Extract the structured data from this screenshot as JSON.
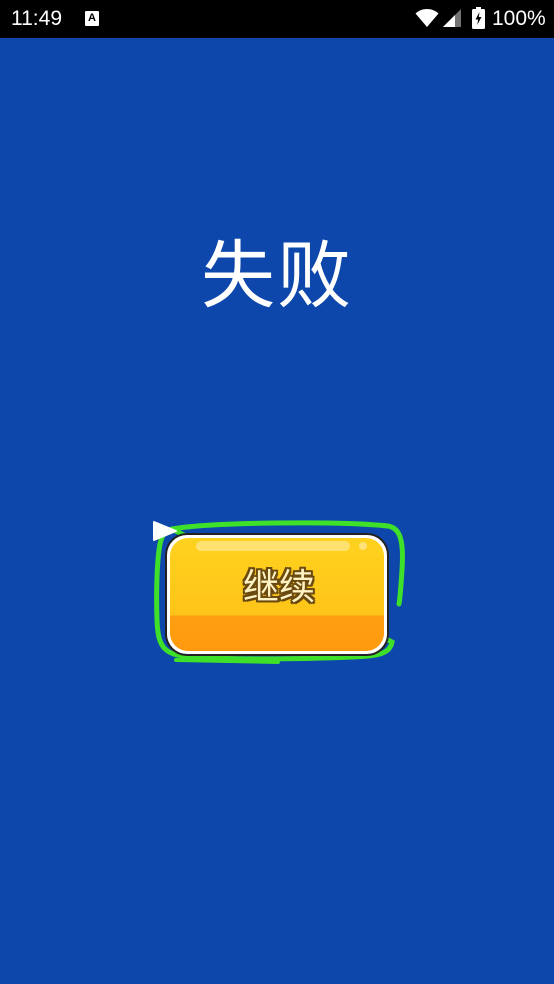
{
  "status_bar": {
    "time": "11:49",
    "notification_letter": "A",
    "battery_percent": "100%"
  },
  "game": {
    "result_title": "失败",
    "continue_label": "继续"
  },
  "colors": {
    "background": "#0d47ab",
    "status_bar": "#000000",
    "button_fill": "#ffc61a",
    "button_bottom": "#ff9f10",
    "button_outline_glow": "#3fe02a"
  },
  "icons": {
    "wifi": "wifi-icon",
    "signal": "signal-icon",
    "battery": "battery-charging-icon",
    "play": "play-icon"
  }
}
